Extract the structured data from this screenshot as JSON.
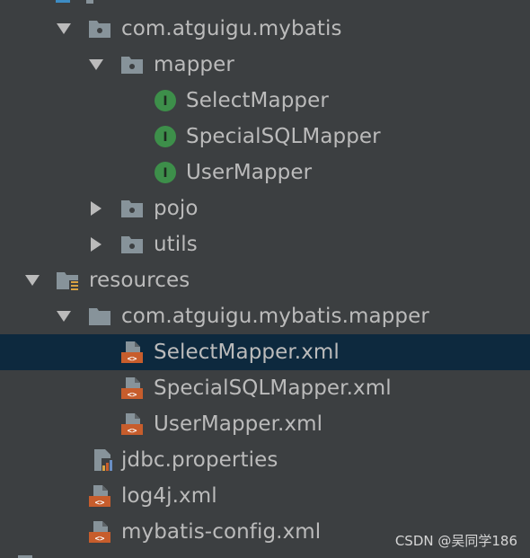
{
  "tree": {
    "rows": [
      {
        "label": "com.atguigu.mybatis",
        "kind": "package",
        "expanded": true
      },
      {
        "label": "mapper",
        "kind": "package",
        "expanded": true
      },
      {
        "label": "SelectMapper",
        "kind": "interface"
      },
      {
        "label": "SpecialSQLMapper",
        "kind": "interface"
      },
      {
        "label": "UserMapper",
        "kind": "interface"
      },
      {
        "label": "pojo",
        "kind": "package",
        "expanded": false
      },
      {
        "label": "utils",
        "kind": "package",
        "expanded": false
      },
      {
        "label": "resources",
        "kind": "resources-folder",
        "expanded": true
      },
      {
        "label": "com.atguigu.mybatis.mapper",
        "kind": "folder",
        "expanded": true
      },
      {
        "label": "SelectMapper.xml",
        "kind": "xml-file",
        "selected": true
      },
      {
        "label": "SpecialSQLMapper.xml",
        "kind": "xml-file"
      },
      {
        "label": "UserMapper.xml",
        "kind": "xml-file"
      },
      {
        "label": "jdbc.properties",
        "kind": "properties-file"
      },
      {
        "label": "log4j.xml",
        "kind": "xml-file"
      },
      {
        "label": "mybatis-config.xml",
        "kind": "xml-file"
      }
    ],
    "interface_badge": "I",
    "xml_badge": "<>"
  },
  "watermark": "CSDN @吴同学186",
  "colors": {
    "background": "#3c3f41",
    "selection": "#0d293e",
    "text": "#bbbbbb",
    "folder": "#87939a",
    "interface_icon": "#3d8f4a",
    "xml_icon": "#c75d2c"
  }
}
